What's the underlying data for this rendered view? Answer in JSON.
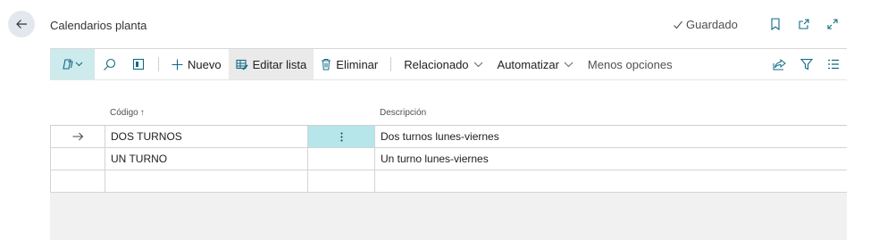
{
  "header": {
    "title": "Calendarios planta",
    "saved_label": "Guardado"
  },
  "actionbar": {
    "new_label": "Nuevo",
    "edit_list_label": "Editar lista",
    "delete_label": "Eliminar",
    "related_label": "Relacionado",
    "automate_label": "Automatizar",
    "less_options_label": "Menos opciones"
  },
  "grid": {
    "columns": {
      "code": "Código",
      "code_sort": "↑",
      "description": "Descripción"
    },
    "rows": [
      {
        "code": "DOS TURNOS",
        "description": "Dos turnos lunes-viernes",
        "selected": true
      },
      {
        "code": "UN TURNO",
        "description": "Un turno lunes-viernes",
        "selected": false
      }
    ]
  },
  "colors": {
    "accent": "#0f6b85",
    "actions_bg": "#cdeaec",
    "active_cell": "#b6e5ea"
  }
}
